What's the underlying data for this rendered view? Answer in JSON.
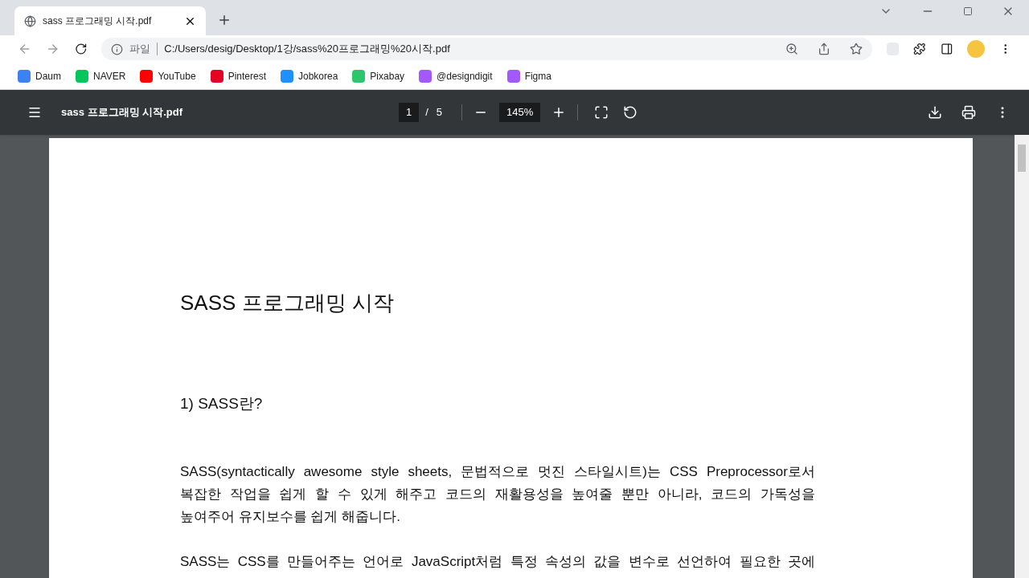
{
  "tab": {
    "title": "sass 프로그래밍 시작.pdf",
    "selected": true
  },
  "address": {
    "scheme_label": "파일",
    "url": "C:/Users/desig/Desktop/1강/sass%20프로그래밍%20시작.pdf"
  },
  "bookmarks": [
    {
      "label": "Daum",
      "kind": "daum"
    },
    {
      "label": "NAVER",
      "kind": "naver"
    },
    {
      "label": "YouTube",
      "kind": "youtube"
    },
    {
      "label": "Pinterest",
      "kind": "pinterest"
    },
    {
      "label": "Jobkorea",
      "kind": "jobkorea"
    },
    {
      "label": "Pixabay",
      "kind": "pixabay"
    },
    {
      "label": "@designdigit",
      "kind": "figma"
    },
    {
      "label": "Figma",
      "kind": "figma"
    }
  ],
  "pdf_toolbar": {
    "title": "sass 프로그래밍 시작.pdf",
    "page": "1",
    "page_sep": "/",
    "page_count": "5",
    "zoom": "145%"
  },
  "document": {
    "title": "SASS 프로그래밍 시작",
    "heading": "1) SASS란?",
    "paragraphs": [
      [
        "SASS(syntactically awesome style sheets, 문법적으로 멋진 스타일시트)는 CSS Preprocessor로서",
        "복잡한 작업을 쉽게 할 수 있게 해주고 코드의 재활용성을 높여줄 뿐만 아니라, 코드의 가독성을",
        "높여주어 유지보수를 쉽게 해줍니다."
      ],
      [
        "SASS는 CSS를 만들어주는 언어로 JavaScript처럼 특정 속성의 값을 변수로 선언하여 필요한 곳에"
      ]
    ]
  }
}
